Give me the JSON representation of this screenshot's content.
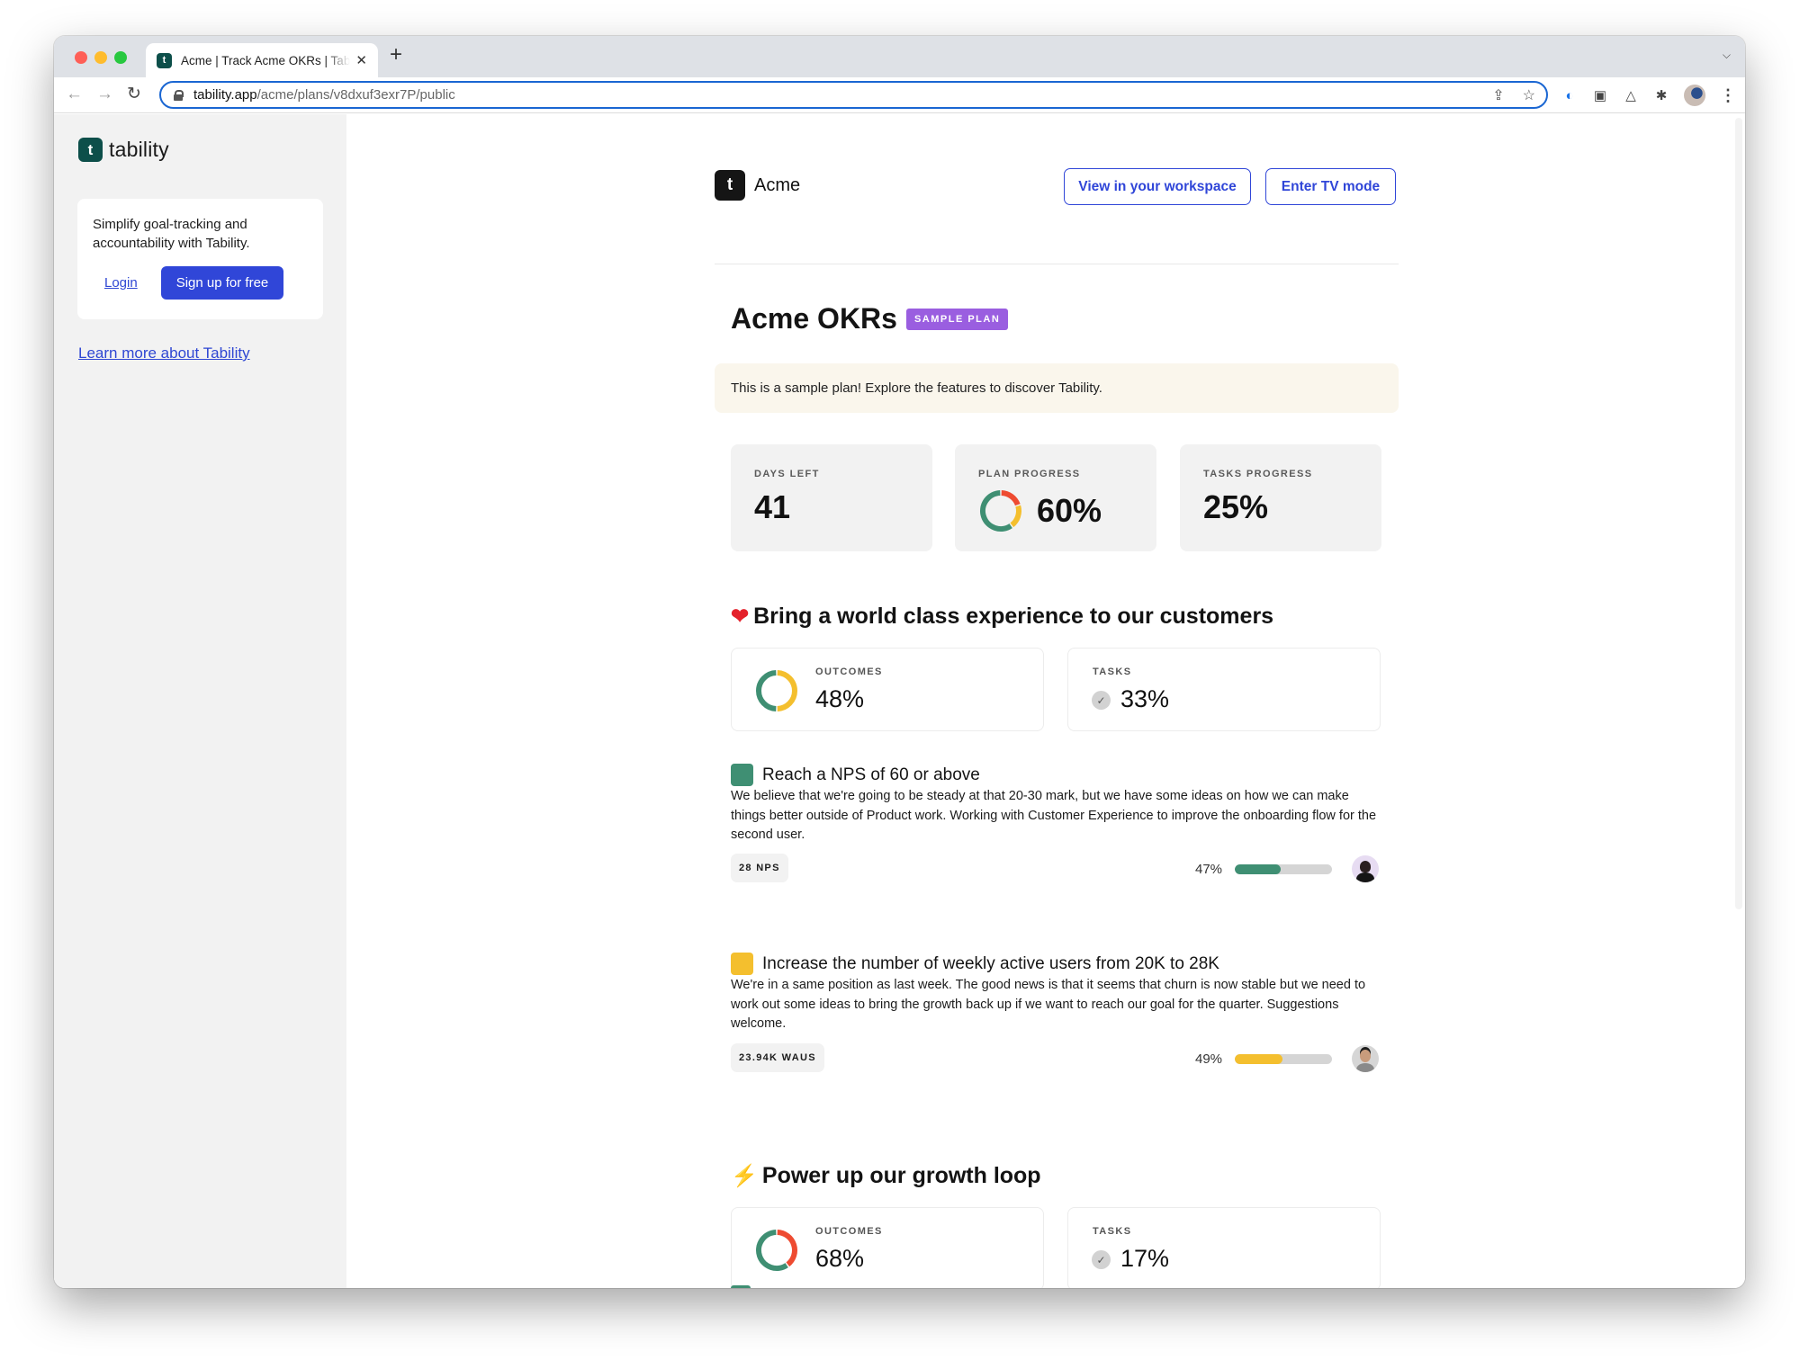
{
  "browser": {
    "tab_title": "Acme | Track Acme OKRs | Tability",
    "favicon_glyph": "t",
    "close_glyph": "✕",
    "new_tab_glyph": "+",
    "dropdown_glyph": "⌄",
    "back_glyph": "←",
    "forward_glyph": "→",
    "reload_glyph": "↻",
    "url_host": "tability.app",
    "url_path": "/acme/plans/v8dxuf3exr7P/public",
    "share_glyph": "⇪",
    "star_glyph": "☆",
    "ext_glyphs": {
      "password": "◐",
      "pip": "▣",
      "drive": "△",
      "puzzle": "✱",
      "menu": "⋮"
    }
  },
  "sidebar": {
    "brand_glyph": "t",
    "brand_name": "tability",
    "promo_text": "Simplify goal-tracking and accountability with Tability.",
    "login_label": "Login",
    "signup_label": "Sign up for free",
    "learn_more_label": "Learn more about Tability"
  },
  "header": {
    "org_glyph": "t",
    "org_name": "Acme",
    "view_workspace_label": "View in your workspace",
    "tv_mode_label": "Enter TV mode"
  },
  "plan": {
    "title": "Acme OKRs",
    "badge": "SAMPLE PLAN",
    "banner": "This is a sample plan! Explore the features to discover Tability."
  },
  "stats": {
    "days_left": {
      "label": "DAYS LEFT",
      "value": "41"
    },
    "plan_progress": {
      "label": "PLAN PROGRESS",
      "value": "60%",
      "donut": [
        {
          "status": "off-track",
          "fraction": 0.2,
          "color": "#ee4b31"
        },
        {
          "status": "at-risk",
          "fraction": 0.2,
          "color": "#f4bf2e"
        },
        {
          "status": "on-track",
          "fraction": 0.6,
          "color": "#3f8f73"
        }
      ]
    },
    "tasks_progress": {
      "label": "TASKS PROGRESS",
      "value": "25%"
    }
  },
  "objectives": [
    {
      "emoji": "❤️",
      "title": "Bring a world class experience to our customers",
      "outcomes_label": "OUTCOMES",
      "outcomes_value": "48%",
      "outcomes_donut": [
        {
          "status": "at-risk",
          "fraction": 0.5,
          "color": "#f4bf2e"
        },
        {
          "status": "on-track",
          "fraction": 0.5,
          "color": "#3f8f73"
        }
      ],
      "tasks_label": "TASKS",
      "tasks_value": "33%",
      "key_results": [
        {
          "title": "Reach a NPS of 60 or above",
          "status_color": "#3f8f73",
          "description": "We believe that we're going to be steady at that 20-30 mark, but we have some ideas on how we can make things better outside of Product work. Working with Customer Experience to improve the onboarding flow for the second user.",
          "metric": "28 NPS",
          "progress_label": "47%",
          "progress": 0.47
        },
        {
          "title": "Increase the number of weekly active users from 20K to 28K",
          "status_color": "#f4bf2e",
          "description": "We're in a same position as last week. The good news is that it seems that churn is now stable but we need to work out some ideas to bring the growth back up if we want to reach our goal for the quarter. Suggestions welcome.",
          "metric": "23.94K WAUS",
          "progress_label": "49%",
          "progress": 0.49
        }
      ]
    },
    {
      "emoji": "⚡",
      "title": "Power up our growth loop",
      "outcomes_label": "OUTCOMES",
      "outcomes_value": "68%",
      "outcomes_donut": [
        {
          "status": "off-track",
          "fraction": 0.4,
          "color": "#ee4b31"
        },
        {
          "status": "on-track",
          "fraction": 0.6,
          "color": "#3f8f73"
        }
      ],
      "tasks_label": "TASKS",
      "tasks_value": "17%"
    }
  ],
  "check_glyph": "✓"
}
